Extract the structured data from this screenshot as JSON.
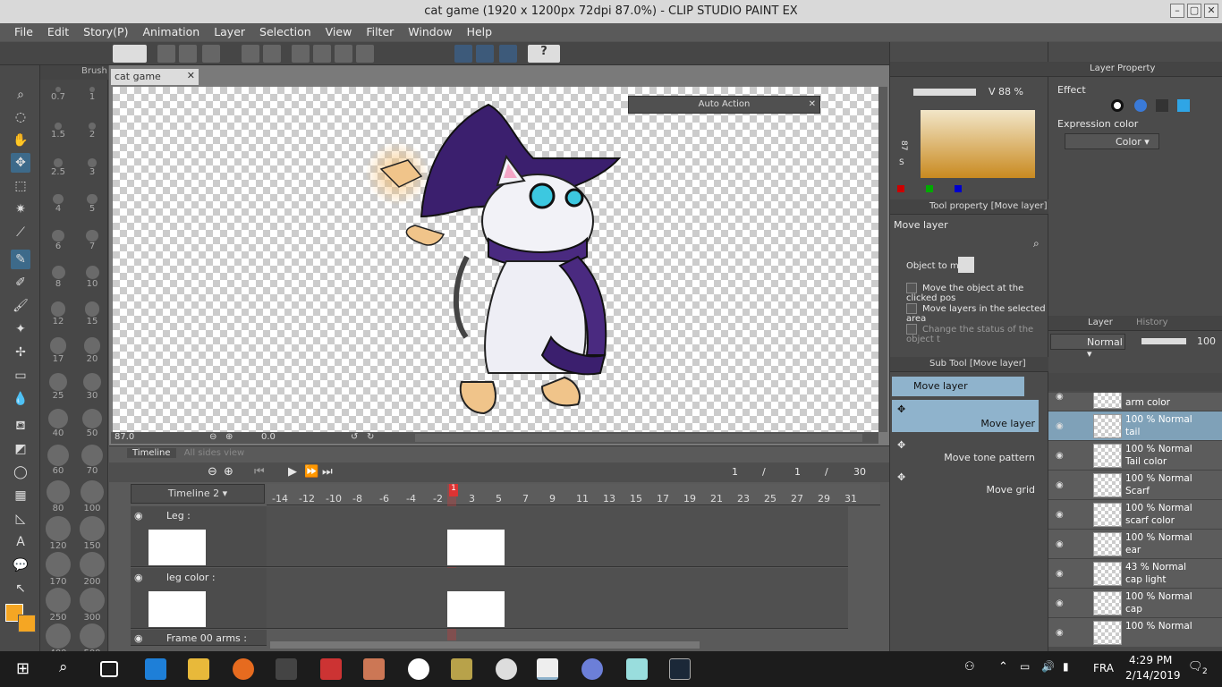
{
  "window": {
    "title": "cat game (1920 x 1200px 72dpi 87.0%)  - CLIP STUDIO PAINT EX"
  },
  "menu": [
    "File",
    "Edit",
    "Story(P)",
    "Animation",
    "Layer",
    "Selection",
    "View",
    "Filter",
    "Window",
    "Help"
  ],
  "left_panel": {
    "brush_tab": "Brush"
  },
  "brush_sizes": [
    [
      "0.7",
      "1"
    ],
    [
      "1.5",
      "2"
    ],
    [
      "2.5",
      "3"
    ],
    [
      "4",
      "5"
    ],
    [
      "6",
      "7"
    ],
    [
      "8",
      "10"
    ],
    [
      "12",
      "15"
    ],
    [
      "17",
      "20"
    ],
    [
      "25",
      "30"
    ],
    [
      "40",
      "50"
    ],
    [
      "60",
      "70"
    ],
    [
      "80",
      "100"
    ],
    [
      "120",
      "150"
    ],
    [
      "170",
      "200"
    ],
    [
      "250",
      "300"
    ],
    [
      "400",
      "500"
    ]
  ],
  "canvas": {
    "tab_label": "cat game",
    "zoom": "87.0",
    "angle": "0.0"
  },
  "auto_action": {
    "title": "Auto Action"
  },
  "timeline": {
    "tab_label": "Timeline",
    "tab2_label": "All sides view",
    "name": "Timeline 2",
    "frame_current": "1",
    "frame_sep1": "/",
    "frame_mid": "1",
    "frame_sep2": "/",
    "frame_total": "30",
    "playhead": "1",
    "ruler": [
      "-14",
      "-12",
      "-10",
      "-8",
      "-6",
      "-4",
      "-2",
      "3",
      "5",
      "7",
      "9",
      "11",
      "13",
      "15",
      "17",
      "19",
      "21",
      "23",
      "25",
      "27",
      "29",
      "31"
    ],
    "tracks": [
      {
        "name": "Leg :"
      },
      {
        "name": "leg color :"
      },
      {
        "name": "Frame 00 arms :"
      }
    ]
  },
  "color_panel": {
    "value_label": "V  88 %",
    "side_label_1": "87",
    "side_label_2": "S"
  },
  "tool_property": {
    "header": "Tool property [Move layer]",
    "title": "Move layer",
    "object_label": "Object to mo",
    "options": [
      "Move the object at the clicked pos",
      "Move layers in the selected area",
      "Change the status of the object t"
    ]
  },
  "sub_tool": {
    "header": "Sub Tool [Move layer]",
    "group": "Move layer",
    "items": [
      "Move layer",
      "Move tone pattern",
      "Move grid"
    ]
  },
  "layer_property": {
    "header": "Layer Property",
    "effect_label": "Effect",
    "expression_label": "Expression color",
    "expression_value": "Color"
  },
  "layer_panel": {
    "tab_layer": "Layer",
    "tab_history": "History",
    "blend_mode": "Normal",
    "opacity": "100",
    "layers": [
      {
        "opacity_mode": "100 % Normal",
        "name": "arm color"
      },
      {
        "opacity_mode": "100 % Normal",
        "name": "tail"
      },
      {
        "opacity_mode": "100 % Normal",
        "name": "Tail color"
      },
      {
        "opacity_mode": "100 % Normal",
        "name": "Scarf"
      },
      {
        "opacity_mode": "100 % Normal",
        "name": "scarf color"
      },
      {
        "opacity_mode": "100 % Normal",
        "name": "ear"
      },
      {
        "opacity_mode": "43 % Normal",
        "name": "cap light"
      },
      {
        "opacity_mode": "100 % Normal",
        "name": "cap"
      },
      {
        "opacity_mode": "100 % Normal",
        "name": ""
      }
    ]
  },
  "taskbar": {
    "time": "4:29 PM",
    "date": "2/14/2019",
    "lang": "FRA",
    "notif": "2"
  },
  "colors": {
    "accent_blue": "#8fb3cc",
    "main_color": "#f5a623",
    "hat_purple": "#3b1f6e"
  }
}
